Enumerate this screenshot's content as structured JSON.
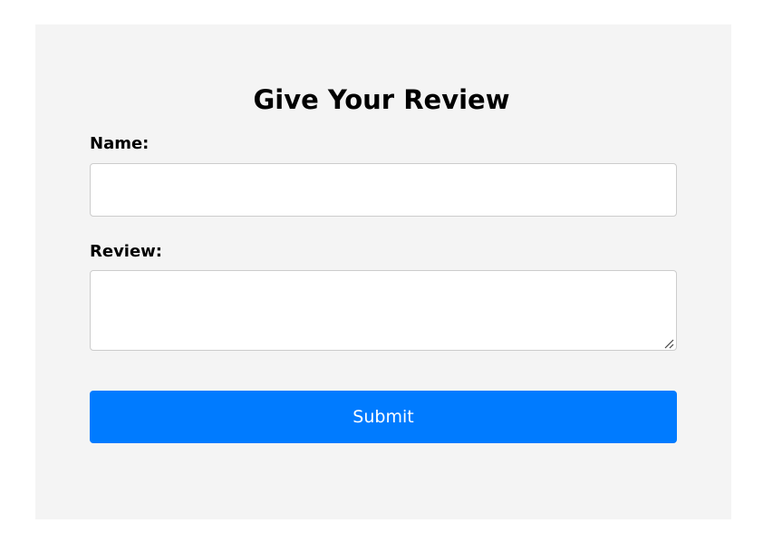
{
  "form": {
    "title": "Give Your Review",
    "name_label": "Name:",
    "name_value": "",
    "name_placeholder": "",
    "review_label": "Review:",
    "review_value": "",
    "review_placeholder": "",
    "submit_label": "Submit"
  },
  "colors": {
    "page_background": "#ffffff",
    "panel_background": "#f4f4f4",
    "input_border": "#cccccc",
    "button_background": "#007bff",
    "button_text": "#ffffff",
    "text": "#000000"
  },
  "icons": {
    "resize_handle": "resize-grip-icon"
  }
}
